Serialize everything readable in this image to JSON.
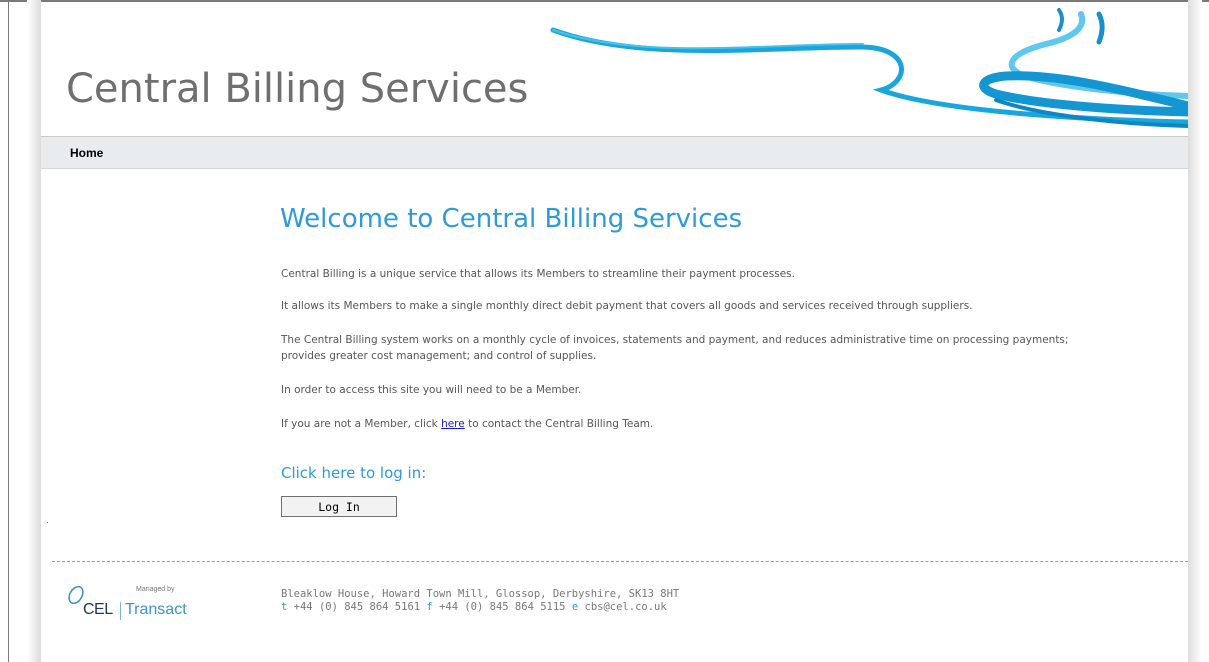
{
  "header": {
    "site_title": "Central Billing Services"
  },
  "nav": {
    "home": "Home"
  },
  "main": {
    "welcome": "Welcome to Central Billing Services",
    "para1": "Central Billing is a unique service that allows its Members to streamline their payment processes.",
    "para2": "It allows its Members to make a single monthly direct debit payment that covers all goods and services received through suppliers.",
    "para3": "The Central Billing system works on a monthly cycle of invoices, statements and payment, and reduces administrative time on processing payments; provides greater cost management; and control of supplies.",
    "para4": "In order to access this site you will need to be a Member.",
    "para5_before": "If you are not a Member, click ",
    "para5_link": "here",
    "para5_after": " to contact the Central Billing Team.",
    "login_heading": "Click here to log in:",
    "login_button": "Log In"
  },
  "footer": {
    "logo_managed": "Managed by",
    "logo_cel": "CEL",
    "logo_transact": "Transact",
    "address": "Bleaklow House, Howard Town Mill, Glossop, Derbyshire, SK13 8HT",
    "t_label": "t",
    "phone": "+44 (0) 845 864 5161",
    "f_label": "f",
    "fax": "+44 (0) 845 864 5115",
    "e_label": "e",
    "email": "cbs@cel.co.uk"
  },
  "colors": {
    "accent": "#2e9ad8",
    "link": "#1515d6",
    "body_text": "#555555",
    "title_grey": "#6f6f6f",
    "nav_bg": "#e9ecee"
  }
}
